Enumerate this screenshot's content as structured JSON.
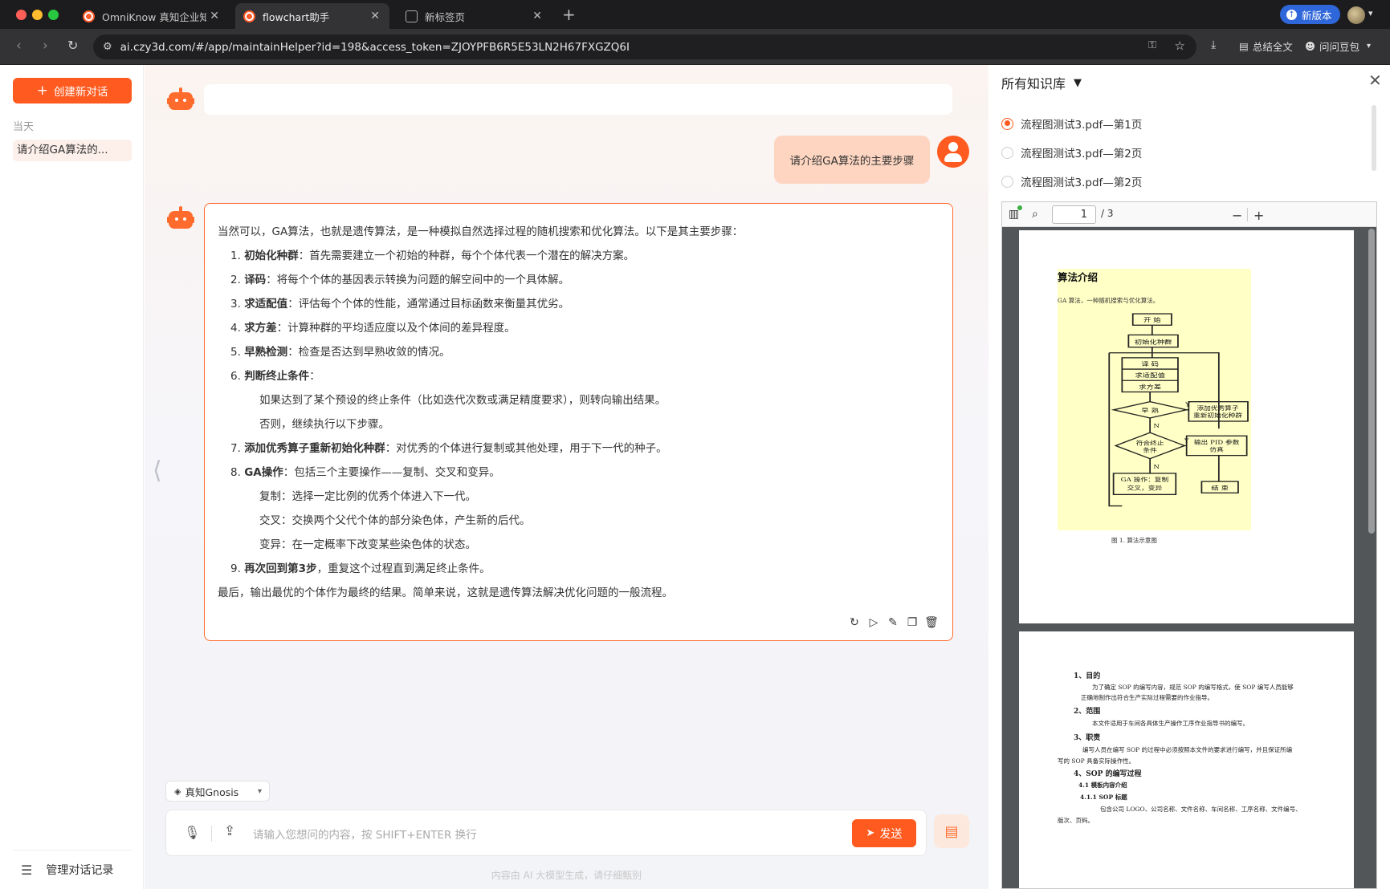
{
  "browser": {
    "tabs": [
      {
        "title": "OmniKnow 真知企业知",
        "close": "✕"
      },
      {
        "title": "flowchart助手",
        "close": "✕"
      },
      {
        "title": "新标签页",
        "close": "✕"
      }
    ],
    "new_version_label": "新版本",
    "url": "ai.czy3d.com/#/app/maintainHelper?id=198&access_token=ZJOYPFB6R5E53LN2H67FXGZQ6I",
    "summarize_label": "总结全文",
    "ask_label": "问问豆包"
  },
  "sidebar": {
    "new_chat_label": "创建新对话",
    "section_label": "当天",
    "history_items": [
      "请介绍GA算法的..."
    ],
    "manage_label": "管理对话记录"
  },
  "chat": {
    "user_message": "请介绍GA算法的主要步骤",
    "answer": {
      "intro": "当然可以，GA算法，也就是遗传算法，是一种模拟自然选择过程的随机搜索和优化算法。以下是其主要步骤：",
      "steps": [
        {
          "num": "1.",
          "title": "初始化种群",
          "text": "：首先需要建立一个初始的种群，每个个体代表一个潜在的解决方案。"
        },
        {
          "num": "2.",
          "title": "译码",
          "text": "：将每个个体的基因表示转换为问题的解空间中的一个具体解。"
        },
        {
          "num": "3.",
          "title": "求适配值",
          "text": "：评估每个个体的性能，通常通过目标函数来衡量其优劣。"
        },
        {
          "num": "4.",
          "title": "求方差",
          "text": "：计算种群的平均适应度以及个体间的差异程度。"
        },
        {
          "num": "5.",
          "title": "早熟检测",
          "text": "：检查是否达到早熟收敛的情况。"
        },
        {
          "num": "6.",
          "title": "判断终止条件",
          "text": "："
        },
        {
          "num": "7.",
          "title": "添加优秀算子重新初始化种群",
          "text": "：对优秀的个体进行复制或其他处理，用于下一代的种子。"
        },
        {
          "num": "8.",
          "title": "GA操作",
          "text": "：包括三个主要操作——复制、交叉和变异。"
        },
        {
          "num": "9.",
          "title": "再次回到第3步",
          "text": "，重复这个过程直到满足终止条件。"
        }
      ],
      "step6_bullets": [
        "如果达到了某个预设的终止条件（比如迭代次数或满足精度要求），则转向输出结果。",
        "否则，继续执行以下步骤。"
      ],
      "step8_bullets": [
        "复制：选择一定比例的优秀个体进入下一代。",
        "交叉：交换两个父代个体的部分染色体，产生新的后代。",
        "变异：在一定概率下改变某些染色体的状态。"
      ],
      "conclusion": "最后，输出最优的个体作为最终的结果。简单来说，这就是遗传算法解决优化问题的一般流程。"
    },
    "kb_selector": "真知Gnosis",
    "input_placeholder": "请输入您想问的内容，按 SHIFT+ENTER 换行",
    "send_label": "发送",
    "disclaimer": "内容由 AI 大模型生成，请仔细甄别"
  },
  "knowledge_panel": {
    "title": "所有知识库",
    "sources": [
      {
        "label": "流程图测试3.pdf—第1页",
        "selected": true
      },
      {
        "label": "流程图测试3.pdf—第2页",
        "selected": false
      },
      {
        "label": "流程图测试3.pdf—第2页",
        "selected": false
      }
    ],
    "pdf": {
      "current_page": "1",
      "total_pages": "/ 3",
      "page1": {
        "heading": "算法介绍",
        "subtitle": "GA 算法，一种随机搜索与优化算法。",
        "flow": {
          "start": "开 始",
          "init": "初始化种群",
          "decode": "译 码",
          "fitness": "求适配值",
          "variance": "求方差",
          "premature": "早 熟",
          "add_operator_1": "添加优秀算子",
          "add_operator_2": "重新初始化种群",
          "terminate_1": "符合终止",
          "terminate_2": "条件",
          "output_1": "输出 PID 参数",
          "output_2": "仿真",
          "ga_op_1": "GA 操作：复制",
          "ga_op_2": "交叉，变异",
          "end": "结 束",
          "yes": "Y",
          "no": "N"
        },
        "caption": "图 1. 算法示意图"
      },
      "page2": {
        "lines": [
          "1、目的",
          "为了确定 SOP 的编写内容，规范 SOP 的编写格式，使 SOP 编写人员能够",
          "正确地制作出符合生产实际过程需要的作业指导。",
          "2、范围",
          "本文件适用于车间各具体生产操作工序作业指导书的编写。",
          "3、职责",
          "编写人员在编写 SOP 的过程中必须按照本文件的要求进行编写，并且保证所编",
          "写的 SOP 具备实际操作性。",
          "4、SOP 的编写过程",
          "4.1 模板内容介绍",
          "4.1.1 SOP 标题",
          "包含公司 LOGO、公司名称、文件名称、车间名称、工序名称、文件编号、",
          "版次、页码。"
        ]
      }
    }
  },
  "colors": {
    "accent": "#ff5a1f",
    "user_bubble": "#fdd5c1",
    "flowchart_bg": "#ffffc6"
  }
}
